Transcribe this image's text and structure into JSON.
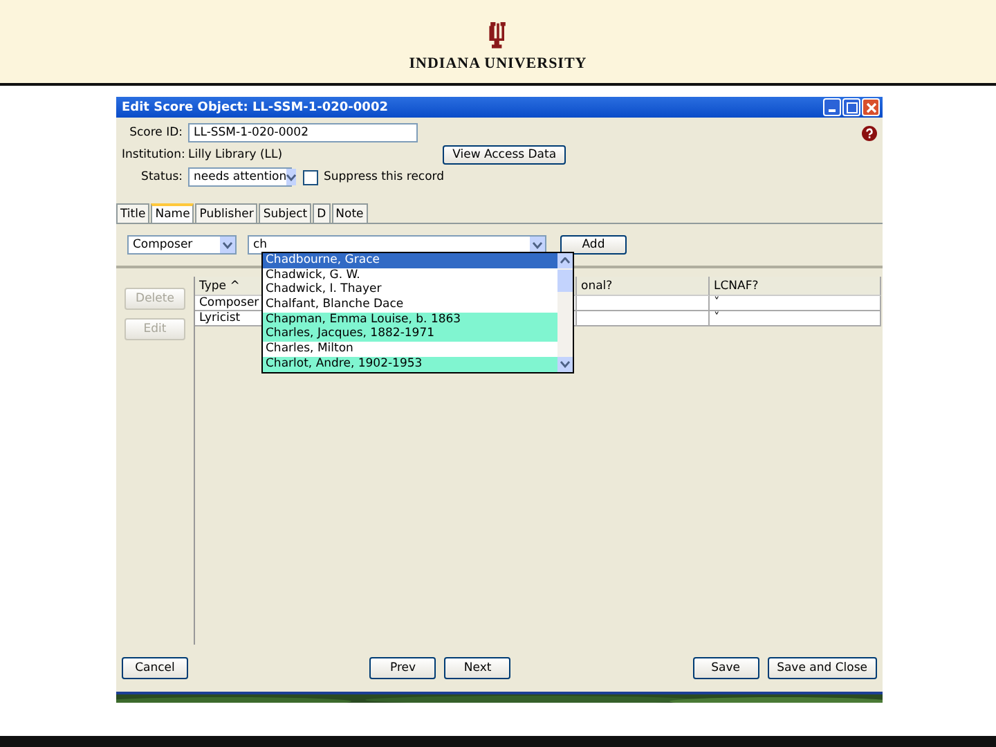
{
  "header": {
    "brand": "INDIANA UNIVERSITY"
  },
  "window": {
    "title": "Edit Score Object: LL-SSM-1-020-0002"
  },
  "form": {
    "score_id_label": "Score ID:",
    "score_id": "LL-SSM-1-020-0002",
    "institution_label": "Institution:",
    "institution": "Lilly Library (LL)",
    "status_label": "Status:",
    "status": "needs attention",
    "suppress": {
      "label": "Suppress this record",
      "checked": false
    },
    "view_access_button": "View Access Data"
  },
  "tabs": [
    {
      "label": "Title",
      "selected": false
    },
    {
      "label": "Name",
      "selected": true
    },
    {
      "label": "Publisher",
      "selected": false
    },
    {
      "label": "Subject",
      "selected": false
    },
    {
      "label": "D",
      "selected": false
    },
    {
      "label": "Note",
      "selected": false
    }
  ],
  "name_entry": {
    "role": "Composer",
    "query": "ch",
    "add_button": "Add",
    "suggestions": [
      {
        "text": "Chadbourne, Grace",
        "selected": true,
        "highlighted": false
      },
      {
        "text": "Chadwick, G. W.",
        "selected": false,
        "highlighted": false
      },
      {
        "text": "Chadwick, I. Thayer",
        "selected": false,
        "highlighted": false
      },
      {
        "text": "Chalfant, Blanche Dace",
        "selected": false,
        "highlighted": false
      },
      {
        "text": "Chapman, Emma Louise, b. 1863",
        "selected": false,
        "highlighted": true
      },
      {
        "text": "Charles, Jacques, 1882-1971",
        "selected": false,
        "highlighted": true
      },
      {
        "text": "Charles, Milton",
        "selected": false,
        "highlighted": false
      },
      {
        "text": "Charlot, Andre, 1902-1953",
        "selected": false,
        "highlighted": true
      }
    ]
  },
  "side_buttons": [
    {
      "label": "Delete",
      "disabled": true
    },
    {
      "label": "Edit",
      "disabled": true
    }
  ],
  "table": {
    "columns": [
      "Type ^",
      "onal?",
      "LCNAF?"
    ],
    "rows": [
      {
        "type": "Composer",
        "lcnaf": "˅"
      },
      {
        "type": "Lyricist",
        "lcnaf": "˅"
      }
    ]
  },
  "buttons": {
    "left": [
      "Cancel"
    ],
    "middle": [
      "Prev",
      "Next"
    ],
    "right": [
      "Save",
      "Save and Close"
    ]
  }
}
